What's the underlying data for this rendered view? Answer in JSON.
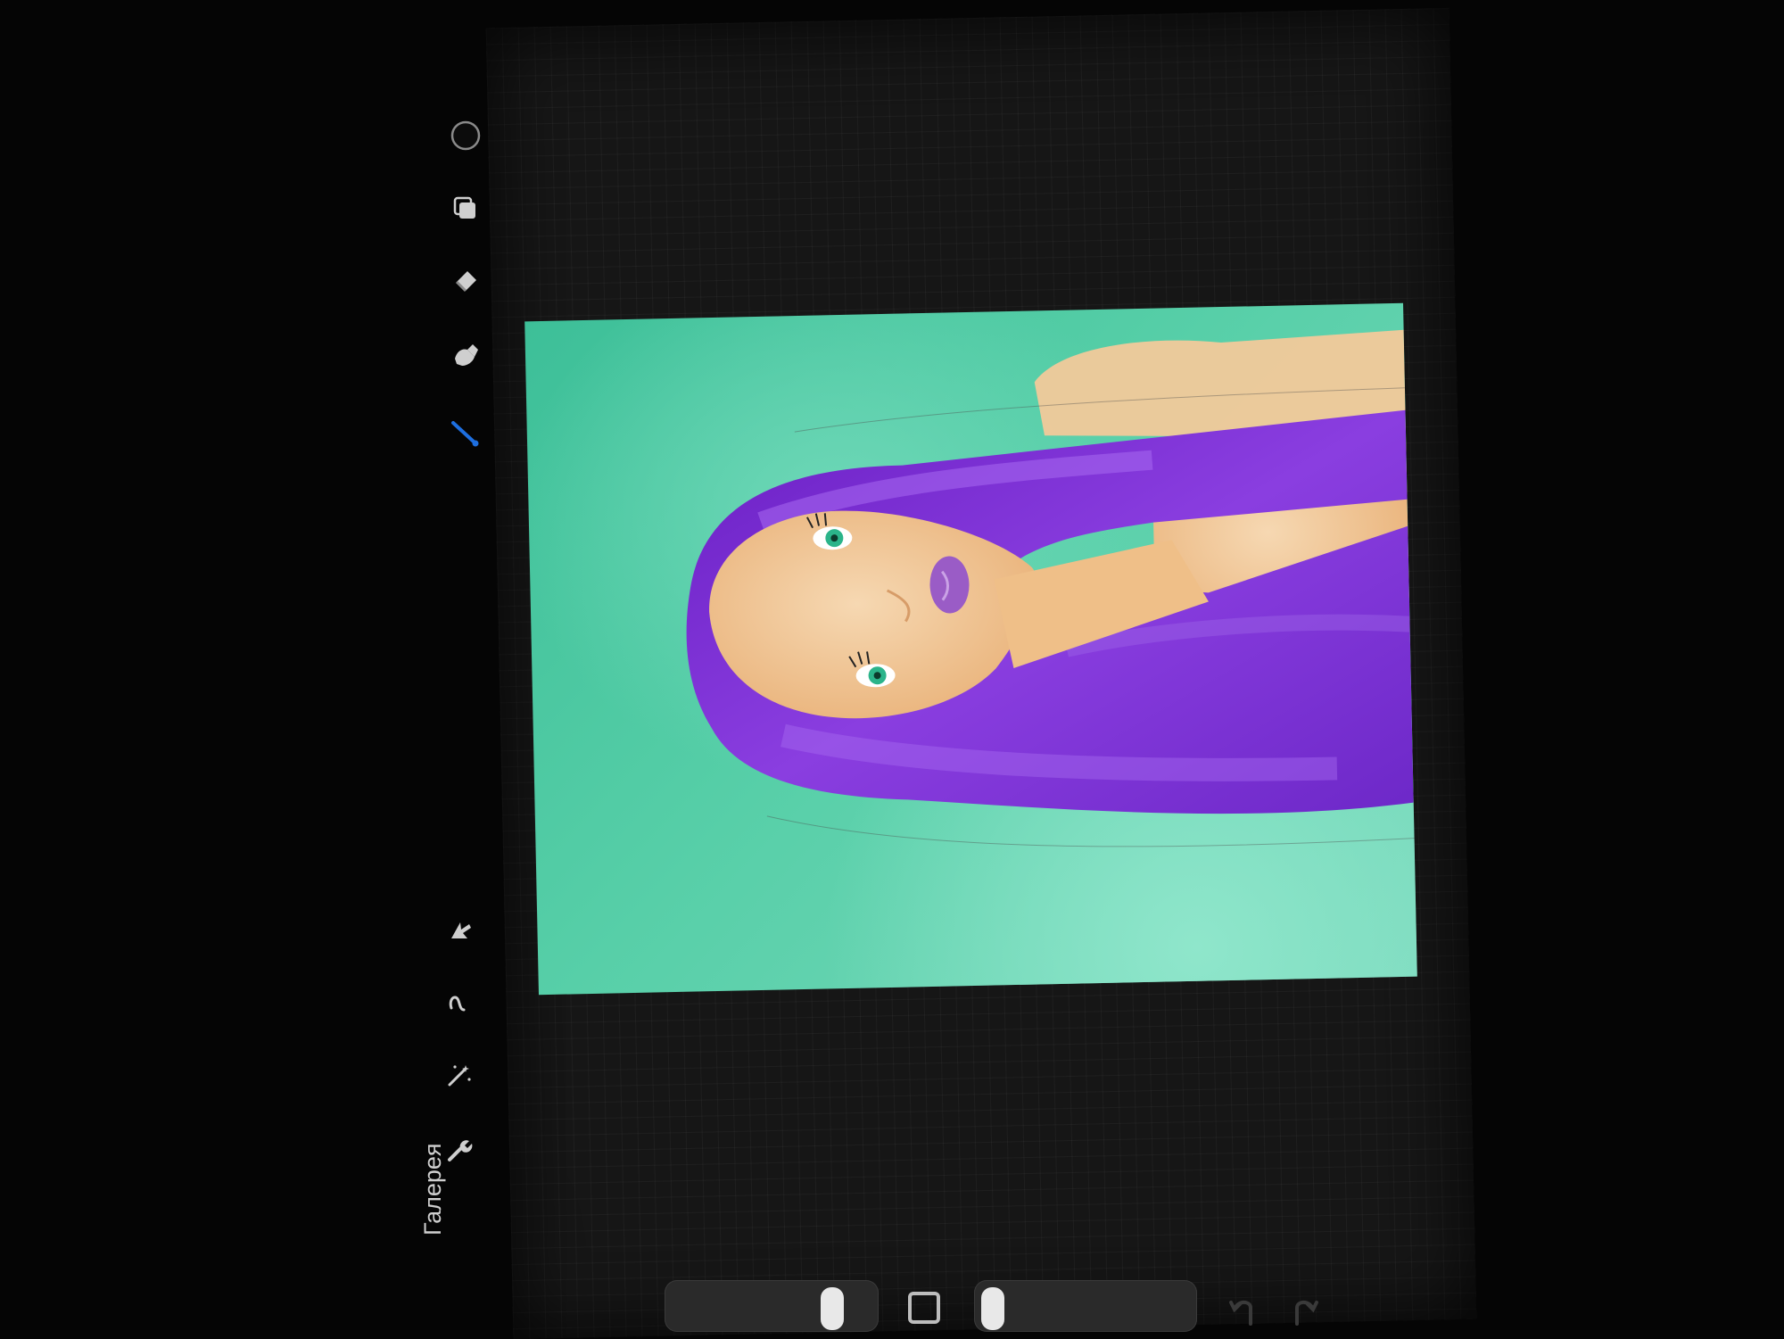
{
  "app": {
    "gallery_label": "Галерея"
  },
  "toolbar": {
    "top_tools": [
      "color-picker",
      "layers",
      "eraser",
      "smudge",
      "brush"
    ],
    "bottom_tools": [
      "select-arrow",
      "transform-s",
      "adjustments-wand",
      "actions-wrench"
    ],
    "active_tool": "brush",
    "active_tool_color": "#1e6fe0"
  },
  "canvas": {
    "background_color": "#4fc9a2",
    "hair_color": "#7b2fd0",
    "skin_color": "#f2c99a",
    "lips_color": "#9a5cc6",
    "eye_color": "#2bb48a"
  },
  "bottom_bar": {
    "brush_size_level": 0.65,
    "opacity_level": 0.08
  },
  "colors": {
    "app_bg": "#050505",
    "screen_bg": "#161616",
    "icon": "#cfcfcf"
  }
}
